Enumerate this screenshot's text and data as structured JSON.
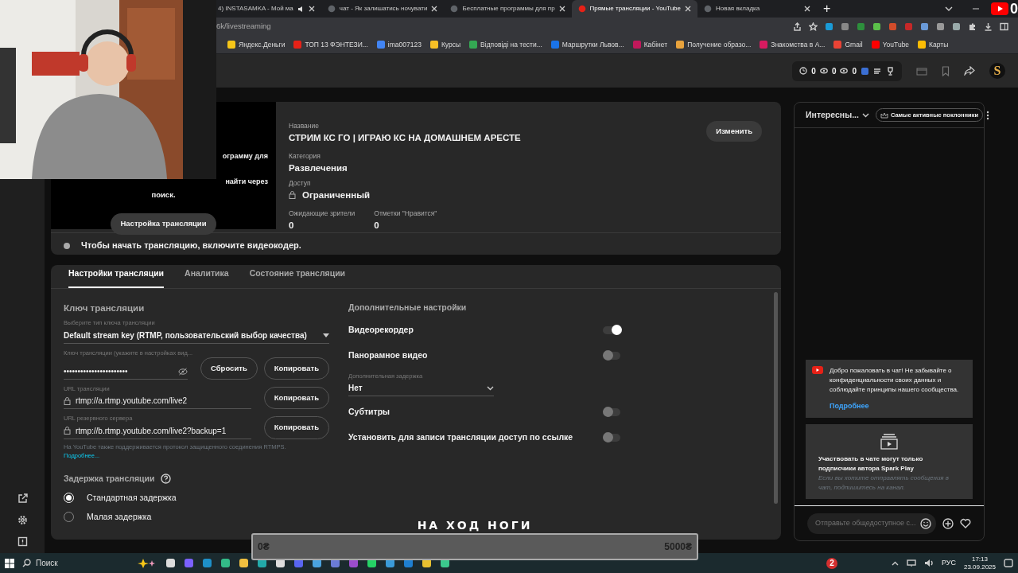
{
  "browser": {
    "tabs": [
      {
        "title": "4) INSTASAMKA - Мой ма",
        "selected": false,
        "audio": true
      },
      {
        "title": "чат - Як залишатись ночувати",
        "selected": false,
        "audio": false
      },
      {
        "title": "Бесплатные программы для пр",
        "selected": false,
        "audio": false
      },
      {
        "title": "Прямые трансляции - YouTube",
        "selected": true,
        "audio": false
      },
      {
        "title": "Новая вкладка",
        "selected": false,
        "audio": false
      }
    ],
    "new_tab": "+",
    "address": "6k/livestreaming",
    "bookmarks": [
      {
        "label": "Яндекс.Деньги",
        "color": "#f5c518"
      },
      {
        "label": "ТОП 13 ФЭНТЕЗИ...",
        "color": "#e62117"
      },
      {
        "label": "ima007123",
        "color": "#4285f4"
      },
      {
        "label": "Курсы",
        "color": "#f6bf26"
      },
      {
        "label": "Відповіді на тести...",
        "color": "#34a853"
      },
      {
        "label": "Маршрутки Львов...",
        "color": "#1a73e8"
      },
      {
        "label": "Кабінет",
        "color": "#c2185b"
      },
      {
        "label": "Получение образо...",
        "color": "#e8a33d"
      },
      {
        "label": "Знакомства в А...",
        "color": "#d81b60"
      },
      {
        "label": "Gmail",
        "color": "#ea4335"
      },
      {
        "label": "YouTube",
        "color": "#ff0000"
      },
      {
        "label": "Карты",
        "color": "#fbbc04"
      }
    ]
  },
  "stream_overlay": {
    "counter": "0",
    "goal_title": "НА ХОД НОГИ",
    "goal_start": "0₴",
    "goal_end": "5000₴"
  },
  "studio_header": {
    "stats": [
      "0",
      "0",
      "0"
    ],
    "avatar_letter": "S"
  },
  "preview": {
    "lines": [
      "ограмму для",
      "найти через"
    ],
    "last_line": "поиск.",
    "button": "Настройка трансляции"
  },
  "stream": {
    "title_label": "Название",
    "title": "СТРИМ КС ГО | ИГРАЮ КС НА ДОМАШНЕМ АРЕСТЕ",
    "category_label": "Категория",
    "category": "Развлечения",
    "access_label": "Доступ",
    "access": "Ограниченный",
    "waiting_label": "Ожидающие зрители",
    "waiting": "0",
    "likes_label": "Отметки \"Нравится\"",
    "likes": "0",
    "edit_button": "Изменить"
  },
  "status": "Чтобы начать трансляцию, включите видеокодер.",
  "tabs": [
    {
      "label": "Настройки трансляции",
      "selected": true
    },
    {
      "label": "Аналитика",
      "selected": false
    },
    {
      "label": "Состояние трансляции",
      "selected": false
    }
  ],
  "stream_key": {
    "heading": "Ключ трансляции",
    "key_type_label": "Выберите тип ключа трансляции",
    "key_type": "Default stream key (RTMP, пользовательский выбор качества)",
    "key_label": "Ключ трансляции (укажите в настройках вид...",
    "key_value": "•••••••••••••••••••••••",
    "reset_button": "Сбросить",
    "copy_button": "Копировать",
    "urls": [
      {
        "label": "URL трансляции",
        "value": "rtmp://a.rtmp.youtube.com/live2",
        "button": "Копировать"
      },
      {
        "label": "URL резервного сервера",
        "value": "rtmp://b.rtmp.youtube.com/live2?backup=1",
        "button": "Копировать"
      }
    ],
    "rtmps_note": "На YouTube также поддерживается протокол защищенного соединения RTMPS.",
    "more_link": "Подробнее...",
    "latency_heading": "Задержка трансляции",
    "latency_options": [
      {
        "label": "Стандартная задержка",
        "selected": true
      },
      {
        "label": "Малая задержка",
        "selected": false
      }
    ]
  },
  "additional": {
    "heading": "Дополнительные настройки",
    "settings": [
      {
        "kind": "toggle",
        "label": "Видеорекордер",
        "on": true
      },
      {
        "kind": "toggle",
        "label": "Панорамное видео",
        "on": false
      },
      {
        "kind": "select",
        "label": "Дополнительная задержка",
        "value": "Нет"
      },
      {
        "kind": "toggle",
        "label": "Субтитры",
        "on": false
      },
      {
        "kind": "toggle",
        "label": "Установить для записи трансляции доступ по ссылке",
        "on": false
      }
    ]
  },
  "chat": {
    "title": "Интересны...",
    "chip": "Самые активные поклонники",
    "welcome": "Добро пожаловать в чат! Не забывайте о конфиденциальности своих данных и соблюдайте принципы нашего сообщества.",
    "welcome_link": "Подробнее",
    "notice_title": "Участвовать в чате могут только подписчики автора Spark Play",
    "notice_text": "Если вы хотите отправлять сообщения в чат, подпишитесь на канал.",
    "input_placeholder": "Отправьте общедоступное с..."
  },
  "taskbar": {
    "search": "Поиск",
    "badge": "2",
    "language": "РУС",
    "time": "17:13",
    "date": "23.09.2025"
  }
}
